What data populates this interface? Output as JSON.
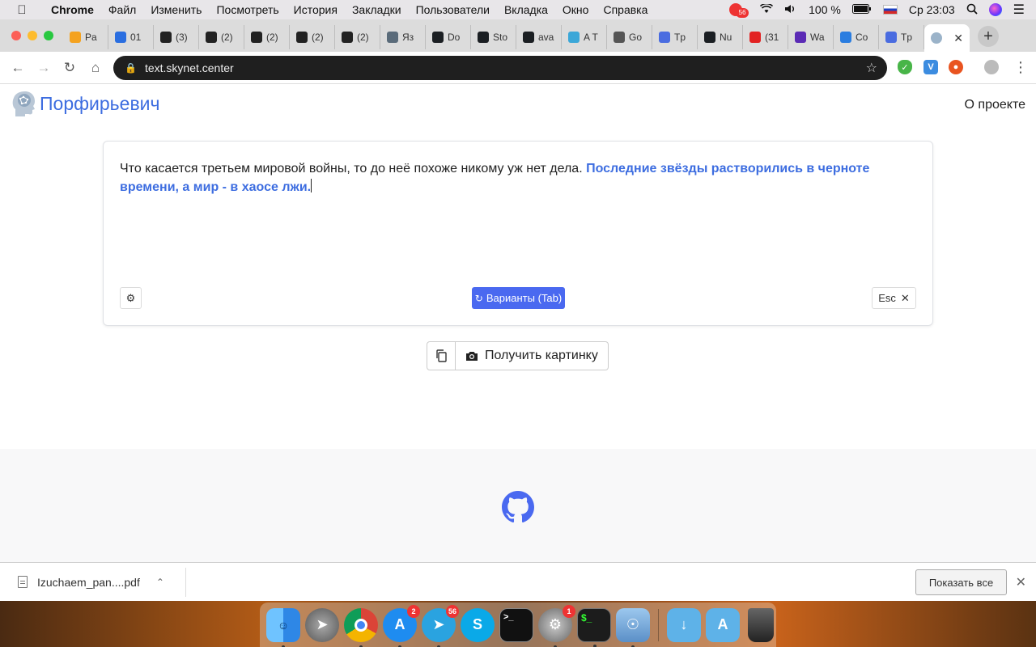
{
  "menubar": {
    "app_name": "Chrome",
    "items": [
      "Файл",
      "Изменить",
      "Посмотреть",
      "История",
      "Закладки",
      "Пользователи",
      "Вкладка",
      "Окно",
      "Справка"
    ],
    "notif_count": "56",
    "battery": "100 %",
    "clock": "Ср 23:03"
  },
  "tabs": [
    {
      "label": "Pa",
      "color": "#f4a21f"
    },
    {
      "label": "01",
      "color": "#2a6ee0"
    },
    {
      "label": "(3)",
      "color": "#222222"
    },
    {
      "label": "(2)",
      "color": "#222222"
    },
    {
      "label": "(2)",
      "color": "#222222"
    },
    {
      "label": "(2)",
      "color": "#222222"
    },
    {
      "label": "(2)",
      "color": "#222222"
    },
    {
      "label": "Яз",
      "color": "#5a6b7a"
    },
    {
      "label": "Do",
      "color": "#1b1f23"
    },
    {
      "label": "Sto",
      "color": "#1b1f23"
    },
    {
      "label": "ava",
      "color": "#1b1f23"
    },
    {
      "label": "A T",
      "color": "#3ba7d8"
    },
    {
      "label": "Go",
      "color": "#555555"
    },
    {
      "label": "Tp",
      "color": "#4a6ce0"
    },
    {
      "label": "Nu",
      "color": "#1b1f23"
    },
    {
      "label": "(31",
      "color": "#e22222"
    },
    {
      "label": "Wa",
      "color": "#5b2bb5"
    },
    {
      "label": "Co",
      "color": "#2a7de0"
    },
    {
      "label": "Tp",
      "color": "#4a6ce0"
    }
  ],
  "toolbar": {
    "url": "text.skynet.center"
  },
  "page": {
    "brand": "Порфирьевич",
    "about_link": "О проекте",
    "editor": {
      "user_text": "Что касается третьем мировой войны, то до неё похоже никому уж нет дела. ",
      "generated_text": "Последние звёзды растворились в черноте времени, а мир - в хаосе лжи."
    },
    "variants_label": "Варианты (Tab)",
    "esc_label": "Esc",
    "get_image_label": "Получить картинку"
  },
  "download": {
    "filename": "Izuchaem_pan....pdf",
    "show_all": "Показать все"
  },
  "dock": {
    "badges": {
      "appstore": "2",
      "telegram": "56",
      "settings": "1"
    }
  },
  "colors": {
    "accent": "#3d6de0",
    "button_primary": "#4a69f0"
  }
}
